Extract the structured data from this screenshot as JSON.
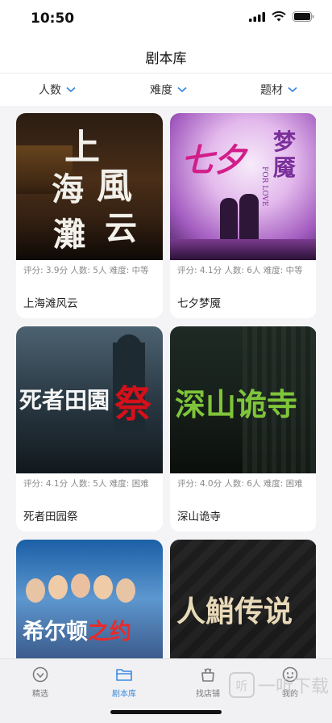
{
  "status": {
    "time": "10:50"
  },
  "nav": {
    "title": "剧本库"
  },
  "filters": [
    {
      "label": "人数"
    },
    {
      "label": "难度"
    },
    {
      "label": "题材"
    }
  ],
  "cards": [
    {
      "title": "上海滩风云",
      "meta": "评分:  3.9分  人数:  5人  难度:  中等",
      "cover_text": "上海滩风云"
    },
    {
      "title": "七夕梦魇",
      "meta": "评分:  4.1分  人数:  6人  难度:  中等",
      "cover_text": "七夕梦魇",
      "cover_sub": "FOR LOVE"
    },
    {
      "title": "死者田园祭",
      "meta": "评分:  4.1分  人数:  5人  难度:  困难",
      "cover_text": "死者田园祭"
    },
    {
      "title": "深山诡寺",
      "meta": "评分:  4.0分  人数:  6人  难度:  困难",
      "cover_text": "深山诡寺"
    },
    {
      "title": "",
      "meta": "",
      "cover_text": "希尔顿之约"
    },
    {
      "title": "",
      "meta": "",
      "cover_text": "人鱼传说"
    }
  ],
  "tabs": [
    {
      "label": "精选",
      "icon": "diamond-icon"
    },
    {
      "label": "剧本库",
      "icon": "folder-icon"
    },
    {
      "label": "找店铺",
      "icon": "shop-icon"
    },
    {
      "label": "我的",
      "icon": "smiley-icon"
    }
  ],
  "watermark": {
    "text": "一听下载",
    "box": "听"
  },
  "colors": {
    "accent": "#3a8be0"
  }
}
